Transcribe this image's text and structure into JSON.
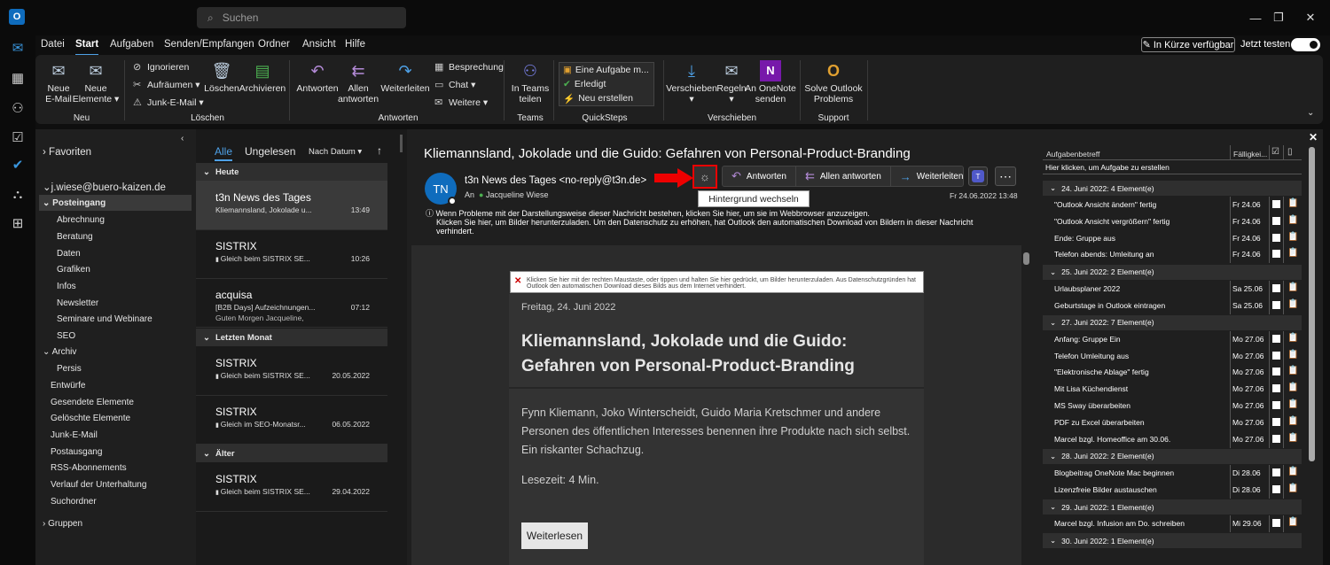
{
  "titlebar": {
    "search_placeholder": "Suchen",
    "minimize": "—",
    "restore": "❐",
    "close": "✕",
    "logo": "O"
  },
  "menu": {
    "tabs": [
      "Datei",
      "Start",
      "Aufgaben",
      "Senden/Empfangen",
      "Ordner",
      "Ansicht",
      "Hilfe"
    ],
    "active": "Start",
    "soon_label": "In Kürze verfügbar",
    "try_label": "Jetzt testen"
  },
  "ribbon": {
    "new_mail": "Neue\nE-Mail",
    "new_items": "Neue\nElemente ▾",
    "group_new": "Neu",
    "ignore": "Ignorieren",
    "cleanup": "Aufräumen ▾",
    "junk": "Junk-E-Mail ▾",
    "delete": "Löschen",
    "archive": "Archivieren",
    "group_delete": "Löschen",
    "reply": "Antworten",
    "reply_all": "Allen\nantworten",
    "forward": "Weiterleiten",
    "meeting": "Besprechung",
    "chat": "Chat ▾",
    "more": "Weitere ▾",
    "group_respond": "Antworten",
    "teams_share": "In Teams\nteilen",
    "group_teams": "Teams",
    "qs_items": [
      "Eine Aufgabe m...",
      "Erledigt",
      "Neu erstellen"
    ],
    "group_quicksteps": "QuickSteps",
    "move": "Verschieben\n▾",
    "rules": "Regeln\n▾",
    "onenote": "An OneNote\nsenden",
    "group_move": "Verschieben",
    "solve": "Solve Outlook\nProblems",
    "group_support": "Support"
  },
  "folders": {
    "favorites": "Favoriten",
    "account": "j.wiese@buero-kaizen.de",
    "inbox": "Posteingang",
    "sub": [
      "Abrechnung",
      "Beratung",
      "Daten",
      "Grafiken",
      "Infos",
      "Newsletter",
      "Seminare und Webinare",
      "SEO"
    ],
    "archive": "Archiv",
    "archive_sub": [
      "Persis"
    ],
    "others": [
      "Entwürfe",
      "Gesendete Elemente",
      "Gelöschte Elemente",
      "Junk-E-Mail",
      "Postausgang",
      "RSS-Abonnements",
      "Verlauf der Unterhaltung",
      "Suchordner"
    ],
    "groups": "Gruppen"
  },
  "list": {
    "tab_all": "Alle",
    "tab_unread": "Ungelesen",
    "sort": "Nach Datum ▾",
    "sort_dir": "↑",
    "headers": [
      "Heute",
      "Letzten Monat",
      "Älter"
    ],
    "items": [
      {
        "sender": "t3n News des Tages",
        "subject": "Kliemannsland, Jokolade u...",
        "time": "13:49",
        "preview": ""
      },
      {
        "sender": "SISTRIX",
        "subject": "Gleich beim SISTRIX SE...",
        "time": "10:26",
        "preview": ""
      },
      {
        "sender": "acquisa",
        "subject": "[B2B Days] Aufzeichnungen...",
        "time": "07:12",
        "preview": "Guten Morgen Jacqueline,"
      },
      {
        "sender": "SISTRIX",
        "subject": "Gleich beim SISTRIX SE...",
        "time": "20.05.2022",
        "preview": ""
      },
      {
        "sender": "SISTRIX",
        "subject": "Gleich im SEO-Monatsr...",
        "time": "06.05.2022",
        "preview": ""
      },
      {
        "sender": "SISTRIX",
        "subject": "Gleich beim SISTRIX SE...",
        "time": "29.04.2022",
        "preview": ""
      }
    ]
  },
  "reading": {
    "subject": "Kliemannsland, Jokolade und die Guido: Gefahren von Personal-Product-Branding",
    "initials": "TN",
    "from": "t3n News des Tages <no-reply@t3n.de>",
    "to_label": "An",
    "to": "Jacqueline Wiese",
    "date": "Fr 24.06.2022 13:48",
    "reply": "Antworten",
    "reply_all": "Allen antworten",
    "forward": "Weiterleiten",
    "teams": "T",
    "tooltip": "Hintergrund wechseln",
    "info1": "Wenn Probleme mit der Darstellungsweise dieser Nachricht bestehen, klicken Sie hier, um sie im Webbrowser anzuzeigen.",
    "info2": "Klicken Sie hier, um Bilder herunterzuladen. Um den Datenschutz zu erhöhen, hat Outlook den automatischen Download von Bildern in dieser Nachricht",
    "info3": "verhindert.",
    "img_notice": "Klicken Sie hier mit der rechten Maustaste, oder tippen und halten Sie hier gedrückt, um Bilder herunterzuladen. Aus Datenschutzgründen hat Outlook den automatischen Download dieses Bilds aus dem Internet verhindert.",
    "body_date": "Freitag, 24. Juni 2022",
    "headline": "Kliemannsland, Jokolade und die Guido: Gefahren von Personal-Product-Branding",
    "paragraph": "Fynn Kliemann, Joko Winterscheidt, Guido Maria Kretschmer und andere Personen des öffentlichen Interesses benennen ihre Produkte nach sich selbst. Ein riskanter Schachzug.",
    "readtime": "Lesezeit: 4 Min.",
    "read_more": "Weiterlesen"
  },
  "tasks": {
    "col_subject": "Aufgabenbetreff",
    "col_due": "Fälligkei...",
    "create_hint": "Hier klicken, um Aufgabe zu erstellen",
    "groups": [
      {
        "label": "24. Juni 2022: 4 Element(e)",
        "items": [
          [
            "\"Outlook Ansicht ändern\" fertig",
            "Fr 24.06"
          ],
          [
            "\"Outlook Ansicht vergrößern\" fertig",
            "Fr 24.06"
          ],
          [
            "Ende: Gruppe aus",
            "Fr 24.06"
          ],
          [
            "Telefon abends: Umleitung an",
            "Fr 24.06"
          ]
        ]
      },
      {
        "label": "25. Juni 2022: 2 Element(e)",
        "items": [
          [
            "Urlaubsplaner 2022",
            "Sa 25.06"
          ],
          [
            "Geburtstage in Outlook eintragen",
            "Sa 25.06"
          ]
        ]
      },
      {
        "label": "27. Juni 2022: 7 Element(e)",
        "items": [
          [
            "Anfang: Gruppe Ein",
            "Mo 27.06"
          ],
          [
            "Telefon Umleitung aus",
            "Mo 27.06"
          ],
          [
            "\"Elektronische Ablage\" fertig",
            "Mo 27.06"
          ],
          [
            "Mit Lisa Küchendienst",
            "Mo 27.06"
          ],
          [
            "MS Sway überarbeiten",
            "Mo 27.06"
          ],
          [
            "PDF zu Excel überarbeiten",
            "Mo 27.06"
          ],
          [
            "Marcel bzgl. Homeoffice am 30.06.",
            "Mo 27.06"
          ]
        ]
      },
      {
        "label": "28. Juni 2022: 2 Element(e)",
        "items": [
          [
            "Blogbeitrag OneNote Mac beginnen",
            "Di 28.06"
          ],
          [
            "Lizenzfreie Bilder austauschen",
            "Di 28.06"
          ]
        ]
      },
      {
        "label": "29. Juni 2022: 1 Element(e)",
        "items": [
          [
            "Marcel bzgl. Infusion am Do. schreiben",
            "Mi 29.06"
          ]
        ]
      },
      {
        "label": "30. Juni 2022: 1 Element(e)",
        "items": []
      }
    ]
  }
}
